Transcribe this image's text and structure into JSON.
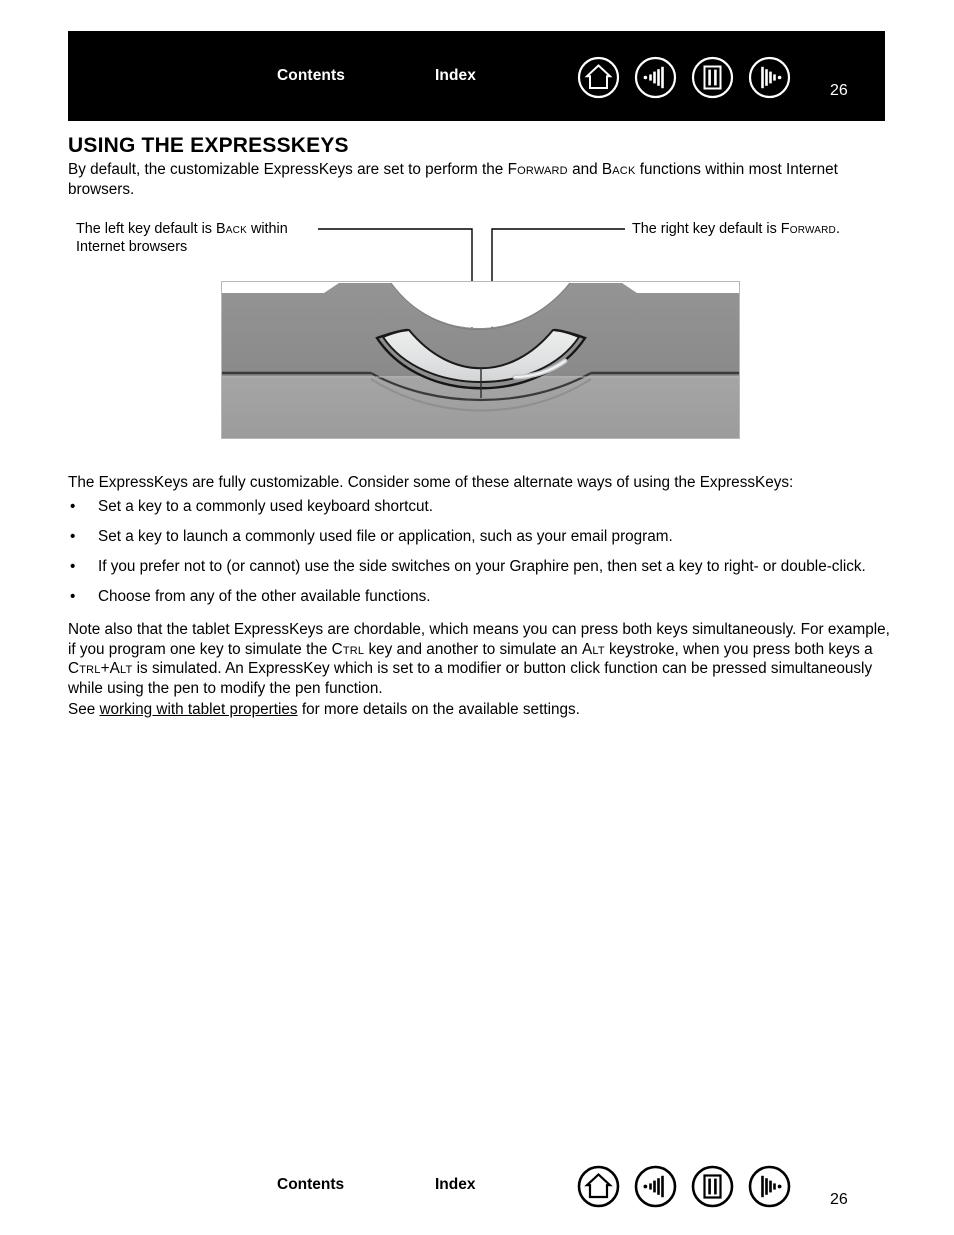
{
  "header": {
    "contents_label": "Contents",
    "index_label": "Index",
    "page_number": "26",
    "background_color": "#000000",
    "text_color": "#ffffff",
    "icons": [
      {
        "name": "home-icon",
        "label": "Home"
      },
      {
        "name": "previous-view-icon",
        "label": "Previous view"
      },
      {
        "name": "pages-icon",
        "label": "Pages"
      },
      {
        "name": "next-view-icon",
        "label": "Next view"
      }
    ]
  },
  "main": {
    "title": "USING THE EXPRESSKEYS",
    "intro": {
      "part1": "By default, the customizable ExpressKeys are set to perform the ",
      "smallcaps1": "Forward",
      "part2": " and ",
      "smallcaps2": "Back",
      "part3": " functions within most Internet browsers."
    },
    "callouts": {
      "left": {
        "part1": "The left key default is ",
        "smallcaps": "Back",
        "part2": " within Internet browsers"
      },
      "right": {
        "part1": "The right key default is ",
        "smallcaps": "Forward",
        "part2": "."
      }
    },
    "figure": {
      "name": "tablet-expresskeys-illustration",
      "body_top_color": "#8e8e8e",
      "body_bottom_color": "#a2a2a2",
      "key_color": "#e3e4e5",
      "outline_color": "#1a1a1a"
    },
    "customizable_para": "The ExpressKeys are fully customizable.  Consider some of these alternate ways of using the ExpressKeys:",
    "bullets": [
      "Set a key to a commonly used keyboard shortcut.",
      "Set a key to launch a commonly used file or application, such as your email program.",
      "If you prefer not to (or cannot) use the side switches on your Graphire pen, then set a key to right- or double-click.",
      "Choose from any of the other available functions."
    ],
    "note_para": {
      "part1": "Note also that the tablet ExpressKeys are chordable, which means you can press both keys simultaneously.  For example, if you program one key to simulate the ",
      "sc1": "Ctrl",
      "part2": " key and another to simulate an ",
      "sc2": "Alt",
      "part3": " keystroke, when you press both keys a ",
      "sc3": "Ctrl",
      "part4": "+",
      "sc4": "Alt",
      "part5": " is simulated.  An ExpressKey which is set to a modifier or button click function can be pressed simultaneously while using the pen to modify the pen function."
    },
    "see_para": {
      "prefix": "See ",
      "link_text": "working with tablet properties",
      "suffix": " for more details on the available settings."
    }
  },
  "footer": {
    "contents_label": "Contents",
    "index_label": "Index",
    "page_number": "26",
    "text_color": "#000000",
    "icons": [
      {
        "name": "home-icon",
        "label": "Home"
      },
      {
        "name": "previous-view-icon",
        "label": "Previous view"
      },
      {
        "name": "pages-icon",
        "label": "Pages"
      },
      {
        "name": "next-view-icon",
        "label": "Next view"
      }
    ]
  }
}
